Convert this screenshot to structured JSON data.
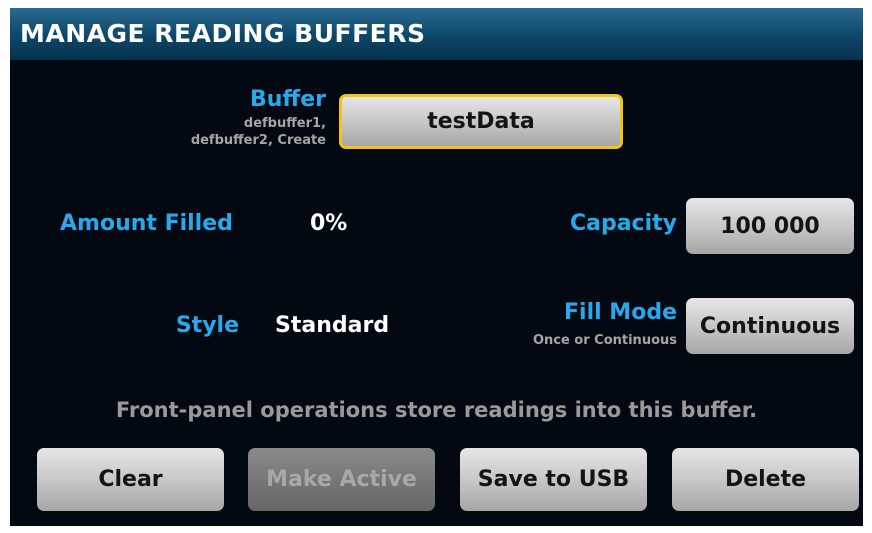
{
  "header": {
    "title": "MANAGE READING BUFFERS"
  },
  "buffer": {
    "label": "Buffer",
    "hint_line1": "defbuffer1,",
    "hint_line2": "defbuffer2, Create",
    "value": "testData"
  },
  "amount_filled": {
    "label": "Amount Filled",
    "value": "0%"
  },
  "capacity": {
    "label": "Capacity",
    "value": "100 000"
  },
  "style": {
    "label": "Style",
    "value": "Standard"
  },
  "fill_mode": {
    "label": "Fill Mode",
    "hint": "Once or Continuous",
    "value": "Continuous"
  },
  "info_text": "Front-panel operations store readings into this buffer.",
  "actions": {
    "clear": "Clear",
    "make_active": "Make Active",
    "save_to_usb": "Save to USB",
    "delete": "Delete"
  },
  "colors": {
    "label": "#27a9ec",
    "focus_border": "#f2c514",
    "background": "#030912",
    "header": "#0d4768"
  }
}
